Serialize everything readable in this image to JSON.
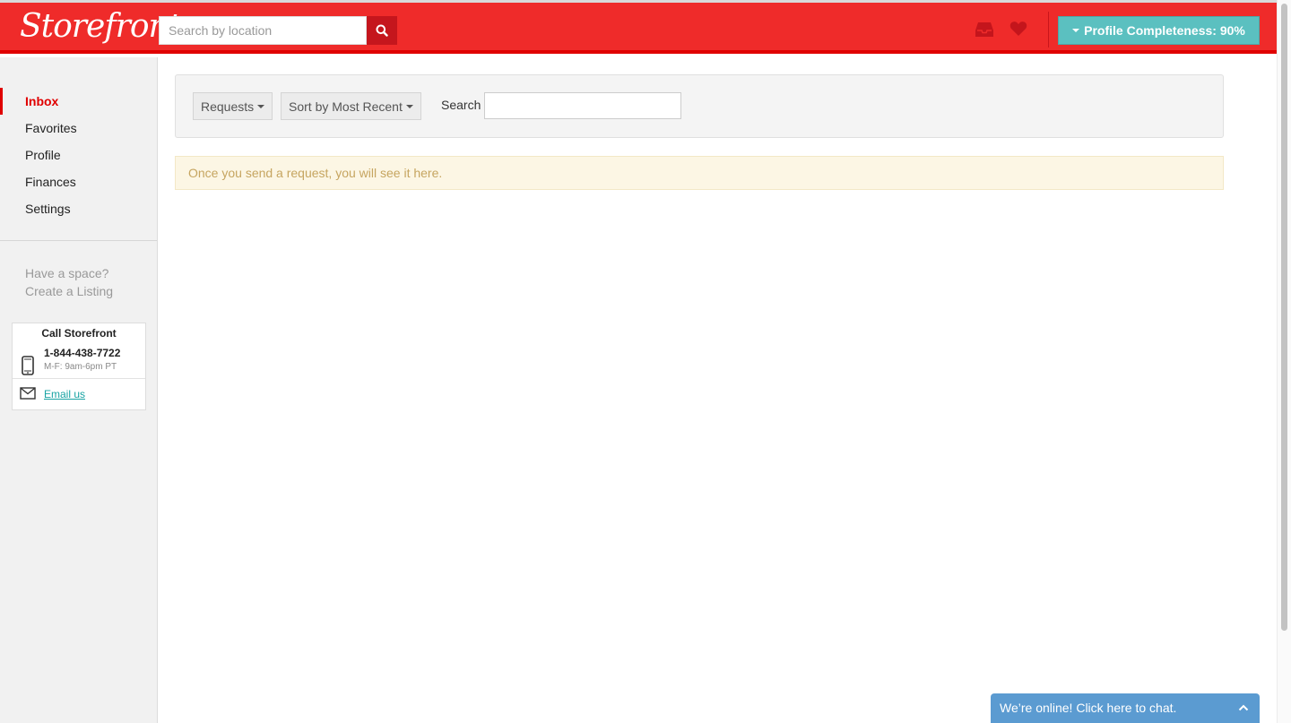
{
  "header": {
    "logo": "Storefront",
    "search_placeholder": "Search by location",
    "profile_button": "Profile Completeness: 90%",
    "icons": [
      "search-icon",
      "inbox-icon",
      "heart-icon",
      "caret-down-icon"
    ],
    "colors": {
      "brand_red": "#ef2b2a",
      "accent_teal": "#5bc0c0"
    }
  },
  "sidebar": {
    "nav": [
      {
        "label": "Inbox",
        "active": true
      },
      {
        "label": "Favorites",
        "active": false
      },
      {
        "label": "Profile",
        "active": false
      },
      {
        "label": "Finances",
        "active": false
      },
      {
        "label": "Settings",
        "active": false
      }
    ],
    "prompt": "Have a space?",
    "create_link": "Create a Listing",
    "contact": {
      "title": "Call Storefront",
      "phone": "1-844-438-7722",
      "hours": "M-F: 9am-6pm PT",
      "email_label": "Email us"
    }
  },
  "filters": {
    "requests_label": "Requests",
    "sort_label": "Sort by Most Recent",
    "search_label": "Search",
    "search_value": ""
  },
  "notice": "Once you send a request, you will see it here.",
  "chat": {
    "label": "We’re online! Click here to chat."
  }
}
